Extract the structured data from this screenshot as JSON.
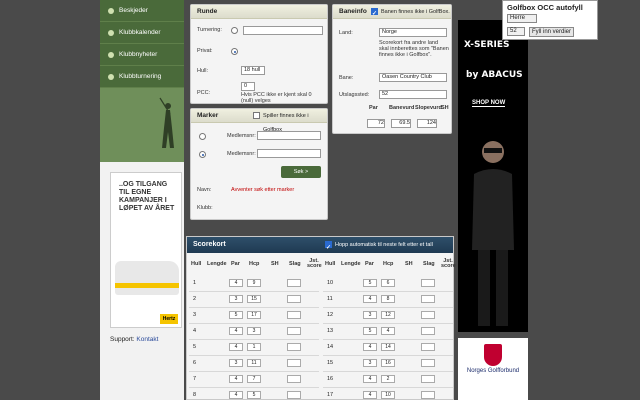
{
  "sidebar": {
    "items": [
      {
        "label": "Beskjeder"
      },
      {
        "label": "Klubbkalender"
      },
      {
        "label": "Klubbnyheter"
      },
      {
        "label": "Klubbturnering"
      }
    ],
    "ad_headline": "..OG TILGANG TIL EGNE KAMPANJER I LØPET AV ÅRET",
    "ad_brand": "Hertz",
    "support_label": "Support:",
    "support_link": "Kontakt"
  },
  "runde": {
    "title": "Runde",
    "turnering_label": "Turnering:",
    "privat_label": "Privat:",
    "hull_label": "Hull:",
    "hull_value": "18 hull",
    "pcc_label": "PCC:",
    "pcc_value": "0",
    "pcc_note": "Hvis PCC ikke er kjent skal 0 (null) velges"
  },
  "baneinfo": {
    "title": "Baneinfo",
    "check_label": "Banen finnes ikke i GolfBox.",
    "land_label": "Land:",
    "land_value": "Norge",
    "note": "Scorekort fra andre land skal innberettes som \"Banen finnes ikke i Golfbox\".",
    "bane_label": "Bane:",
    "bane_value": "Oasen Country Club",
    "utslag_label": "Utslagssted:",
    "utslag_value": "52",
    "col_par": "Par",
    "col_rating": "Banevurd",
    "col_slope": "Slopevurd",
    "col_sh": "SH",
    "par": "72",
    "rating": "69.5",
    "slope": "124"
  },
  "marker": {
    "title": "Marker",
    "check_label": "Spiller finnes ikke i Golfbox",
    "medlem_label": "Medlemsnr:",
    "medlem_label2": "Medlemsnr:",
    "sok_label": "Søk >",
    "navn_label": "Navn:",
    "navn_value": "Avventer søk etter marker",
    "klubb_label": "Klubb:"
  },
  "scorecard": {
    "title": "Scorekort",
    "auto_label": "Hopp automatisk til neste felt etter et tall",
    "headers": [
      "Hull",
      "Lengde",
      "Par",
      "Hcp",
      "SH",
      "Slag",
      "Jst. score"
    ],
    "left": [
      {
        "hull": "1",
        "par": "4",
        "hcp": "9"
      },
      {
        "hull": "2",
        "par": "3",
        "hcp": "15"
      },
      {
        "hull": "3",
        "par": "5",
        "hcp": "17"
      },
      {
        "hull": "4",
        "par": "4",
        "hcp": "3"
      },
      {
        "hull": "5",
        "par": "4",
        "hcp": "1"
      },
      {
        "hull": "6",
        "par": "3",
        "hcp": "11"
      },
      {
        "hull": "7",
        "par": "4",
        "hcp": "7"
      },
      {
        "hull": "8",
        "par": "4",
        "hcp": "5"
      }
    ],
    "right": [
      {
        "hull": "10",
        "par": "5",
        "hcp": "6"
      },
      {
        "hull": "11",
        "par": "4",
        "hcp": "8"
      },
      {
        "hull": "12",
        "par": "3",
        "hcp": "12"
      },
      {
        "hull": "13",
        "par": "5",
        "hcp": "4"
      },
      {
        "hull": "14",
        "par": "4",
        "hcp": "14"
      },
      {
        "hull": "15",
        "par": "3",
        "hcp": "16"
      },
      {
        "hull": "16",
        "par": "4",
        "hcp": "2"
      },
      {
        "hull": "17",
        "par": "4",
        "hcp": "10"
      }
    ]
  },
  "ad_right": {
    "line1": "X-SERIES",
    "line2": "by ABACUS",
    "cta": "SHOP NOW"
  },
  "ngf": {
    "text": "Norges Golfforbund"
  },
  "popup": {
    "title": "Golfbox OCC autofyll",
    "select1": "Herre",
    "select2": "52",
    "button": "Fyll inn verdier"
  }
}
